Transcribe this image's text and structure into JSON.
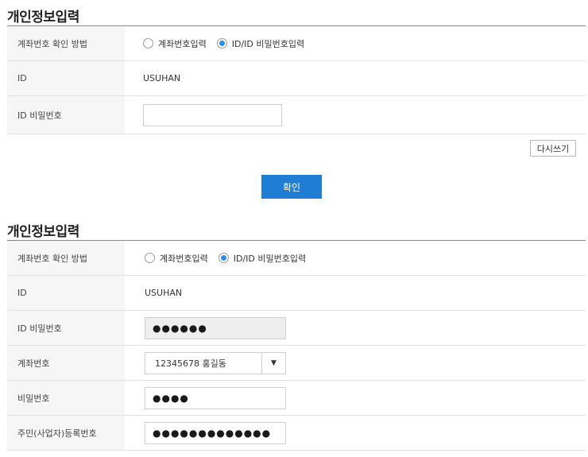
{
  "section1": {
    "title": "개인정보입력",
    "rows": {
      "method": {
        "label": "계좌번호 확인 방법",
        "options": [
          "계좌번호입력",
          "ID/ID 비밀번호입력"
        ],
        "selected": "ID/ID 비밀번호입력"
      },
      "id": {
        "label": "ID",
        "value": "USUHAN"
      },
      "password": {
        "label": "ID 비밀번호",
        "value": ""
      }
    },
    "reset_label": "다시쓰기",
    "confirm_label": "확인"
  },
  "section2": {
    "title": "개인정보입력",
    "rows": {
      "method": {
        "label": "계좌번호 확인 방법",
        "options": [
          "계좌번호입력",
          "ID/ID 비밀번호입력"
        ],
        "selected": "ID/ID 비밀번호입력"
      },
      "id": {
        "label": "ID",
        "value": "USUHAN"
      },
      "id_password": {
        "label": "ID 비밀번호",
        "value": "●●●●●●"
      },
      "account": {
        "label": "계좌번호",
        "value": "12345678 홍길동",
        "arrow": "▼"
      },
      "account_password": {
        "label": "비밀번호",
        "value": "●●●●"
      },
      "resident_number": {
        "label": "주민(사업자)등록번호",
        "value": "●●●●●●●●●●●●●"
      }
    }
  },
  "icons": {
    "select_arrow": "chevron-down-icon",
    "radio_checked": "radio-checked-icon",
    "radio_unchecked": "radio-unchecked-icon"
  },
  "colors": {
    "primary": "#1f7ed4",
    "radio_accent": "#2f8ee0",
    "label_bg": "#f6f6f6",
    "border": "#e2e2e2"
  }
}
